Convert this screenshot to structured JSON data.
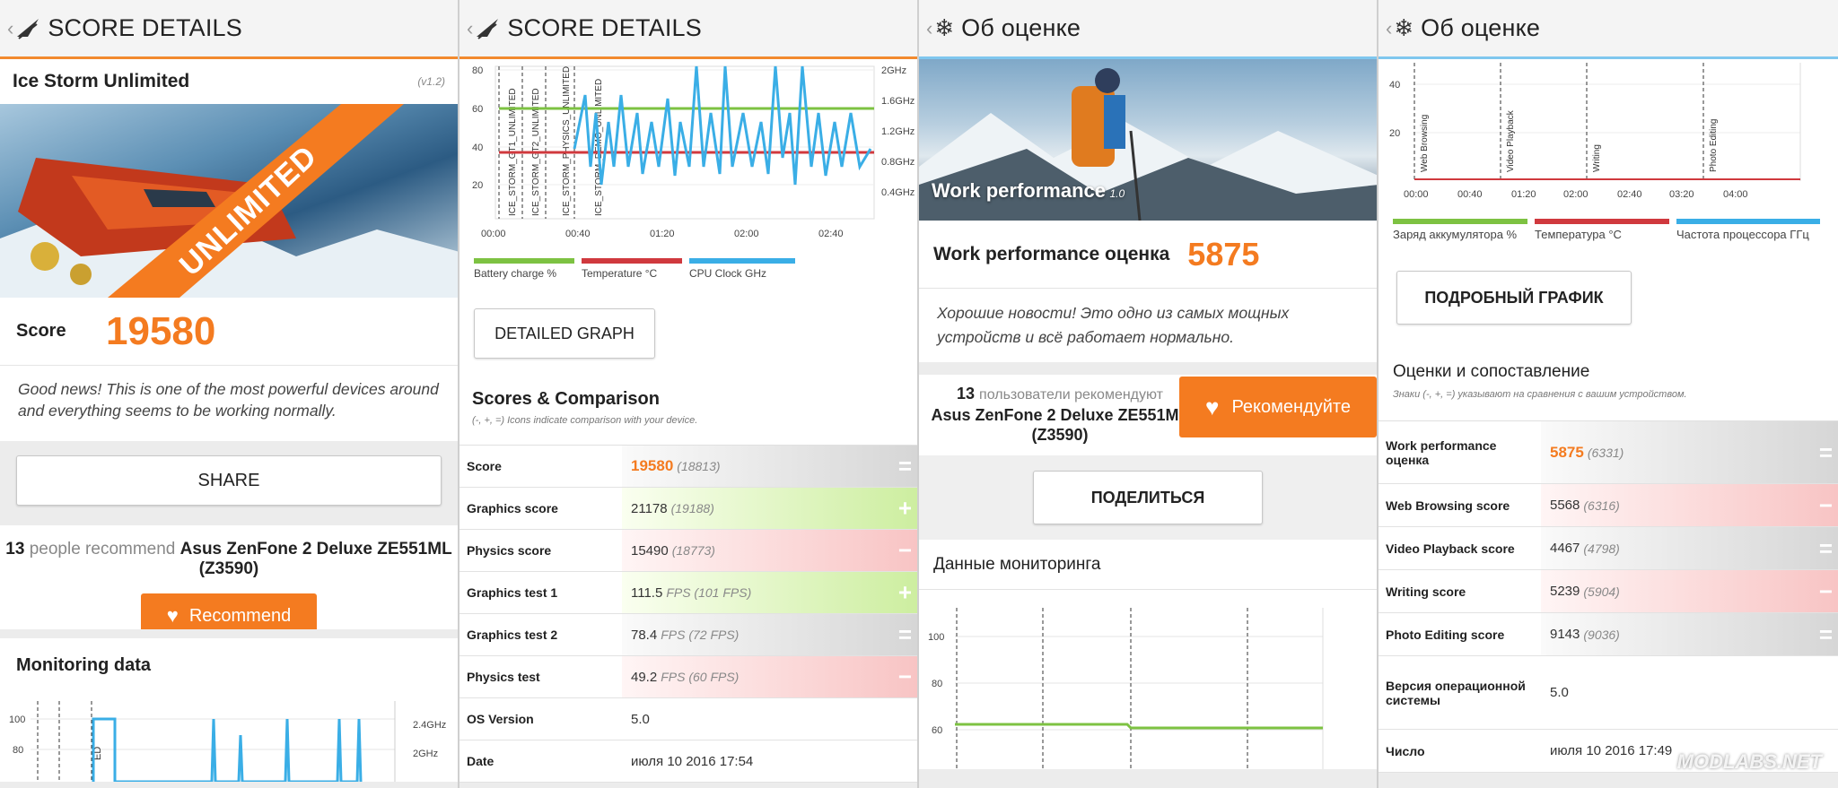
{
  "s1": {
    "title": "SCORE DETAILS",
    "test_name": "Ice Storm Unlimited",
    "version": "(v1.2)",
    "banner_text": "UNLIMITED",
    "score_label": "Score",
    "score_value": "19580",
    "good_news": "Good news! This is one of the most powerful devices around and everything seems to be working normally.",
    "share": "SHARE",
    "rec_count": "13",
    "rec_text": "people recommend",
    "device": "Asus ZenFone 2 Deluxe ZE551ML (Z3590)",
    "recommend": "Recommend",
    "monitoring": "Monitoring data",
    "y_ticks": [
      "100",
      "80"
    ],
    "r_ticks": [
      "2.4GHz",
      "2GHz"
    ],
    "marker": "ED"
  },
  "s2": {
    "title": "SCORE DETAILS",
    "chart": {
      "y_ticks": [
        "80",
        "60",
        "40",
        "20"
      ],
      "r_ticks": [
        "2GHz",
        "1.6GHz",
        "1.2GHz",
        "0.8GHz",
        "0.4GHz"
      ],
      "x_ticks": [
        "00:00",
        "00:40",
        "01:20",
        "02:00",
        "02:40"
      ],
      "markers": [
        "ICE_STORM_GT1_UNLIMITED",
        "ICE_STORM_GT2_UNLIMITED",
        "ICE_STORM_PHYSICS_UNLIMITED",
        "ICE_STORM_DEMO_UNLIMITED"
      ]
    },
    "legend": [
      "Battery charge %",
      "Temperature °C",
      "CPU Clock GHz"
    ],
    "detailed": "DETAILED GRAPH",
    "scores_title": "Scores & Comparison",
    "scores_sub": "(-, +, =) Icons indicate comparison with your device.",
    "rows": [
      {
        "label": "Score",
        "value": "19580",
        "cmp": "(18813)",
        "sign": "=",
        "cls": "eq",
        "orange": true
      },
      {
        "label": "Graphics score",
        "value": "21178",
        "cmp": "(19188)",
        "sign": "+",
        "cls": "plus"
      },
      {
        "label": "Physics score",
        "value": "15490",
        "cmp": "(18773)",
        "sign": "−",
        "cls": "minus"
      },
      {
        "label": "Graphics test 1",
        "value": "111.5",
        "cmp": "FPS (101 FPS)",
        "sign": "+",
        "cls": "plus"
      },
      {
        "label": "Graphics test 2",
        "value": "78.4",
        "cmp": "FPS (72 FPS)",
        "sign": "=",
        "cls": "eq"
      },
      {
        "label": "Physics test",
        "value": "49.2",
        "cmp": "FPS (60 FPS)",
        "sign": "−",
        "cls": "minus"
      },
      {
        "label": "OS Version",
        "value": "5.0",
        "cmp": "",
        "sign": "",
        "cls": "none"
      },
      {
        "label": "Date",
        "value": "июля 10 2016 17:54",
        "cmp": "",
        "sign": "",
        "cls": "none"
      }
    ]
  },
  "s3": {
    "title": "Об оценке",
    "banner_label": "Work performance",
    "banner_ver": "1.0",
    "score_label": "Work performance оценка",
    "score_value": "5875",
    "good_news": "Хорошие новости! Это одно из самых мощных устройств и всё работает нормально.",
    "rec_count": "13",
    "rec_text": "пользователи рекомендуют",
    "device": "Asus ZenFone 2 Deluxe ZE551ML (Z3590)",
    "recommend": "Рекомендуйте",
    "share": "ПОДЕЛИТЬСЯ",
    "monitoring": "Данные мониторинга",
    "y_ticks": [
      "100",
      "80",
      "60"
    ]
  },
  "s4": {
    "title": "Об оценке",
    "chart": {
      "y_ticks": [
        "40",
        "20"
      ],
      "x_ticks": [
        "00:00",
        "00:40",
        "01:20",
        "02:00",
        "02:40",
        "03:20",
        "04:00"
      ],
      "markers": [
        "Web Browsing",
        "Video Playback",
        "Writing",
        "Photo Editing"
      ]
    },
    "legend": [
      "Заряд аккумулятора %",
      "Температура °C",
      "Частота процессора ГГц"
    ],
    "detailed": "ПОДРОБНЫЙ ГРАФИК",
    "scores_title": "Оценки и сопоставление",
    "scores_sub": "Знаки (-, +, =) указывают на сравнения с вашим устройством.",
    "rows": [
      {
        "label": "Work performance оценка",
        "value": "5875",
        "cmp": "(6331)",
        "sign": "=",
        "cls": "eq",
        "orange": true
      },
      {
        "label": "Web Browsing score",
        "value": "5568",
        "cmp": "(6316)",
        "sign": "−",
        "cls": "minus"
      },
      {
        "label": "Video Playback score",
        "value": "4467",
        "cmp": "(4798)",
        "sign": "=",
        "cls": "eq"
      },
      {
        "label": "Writing score",
        "value": "5239",
        "cmp": "(5904)",
        "sign": "−",
        "cls": "minus"
      },
      {
        "label": "Photo Editing score",
        "value": "9143",
        "cmp": "(9036)",
        "sign": "=",
        "cls": "eq"
      },
      {
        "label": "Версия операционной системы",
        "value": "5.0",
        "cmp": "",
        "sign": "",
        "cls": "none"
      },
      {
        "label": "Число",
        "value": "июля 10 2016 17:49",
        "cmp": "",
        "sign": "",
        "cls": "none"
      }
    ],
    "watermark": "MODLABS.NET"
  },
  "colors": {
    "accent": "#f47b20",
    "battery": "#7dc242",
    "temp": "#d0393e",
    "cpu": "#3aaee6"
  }
}
